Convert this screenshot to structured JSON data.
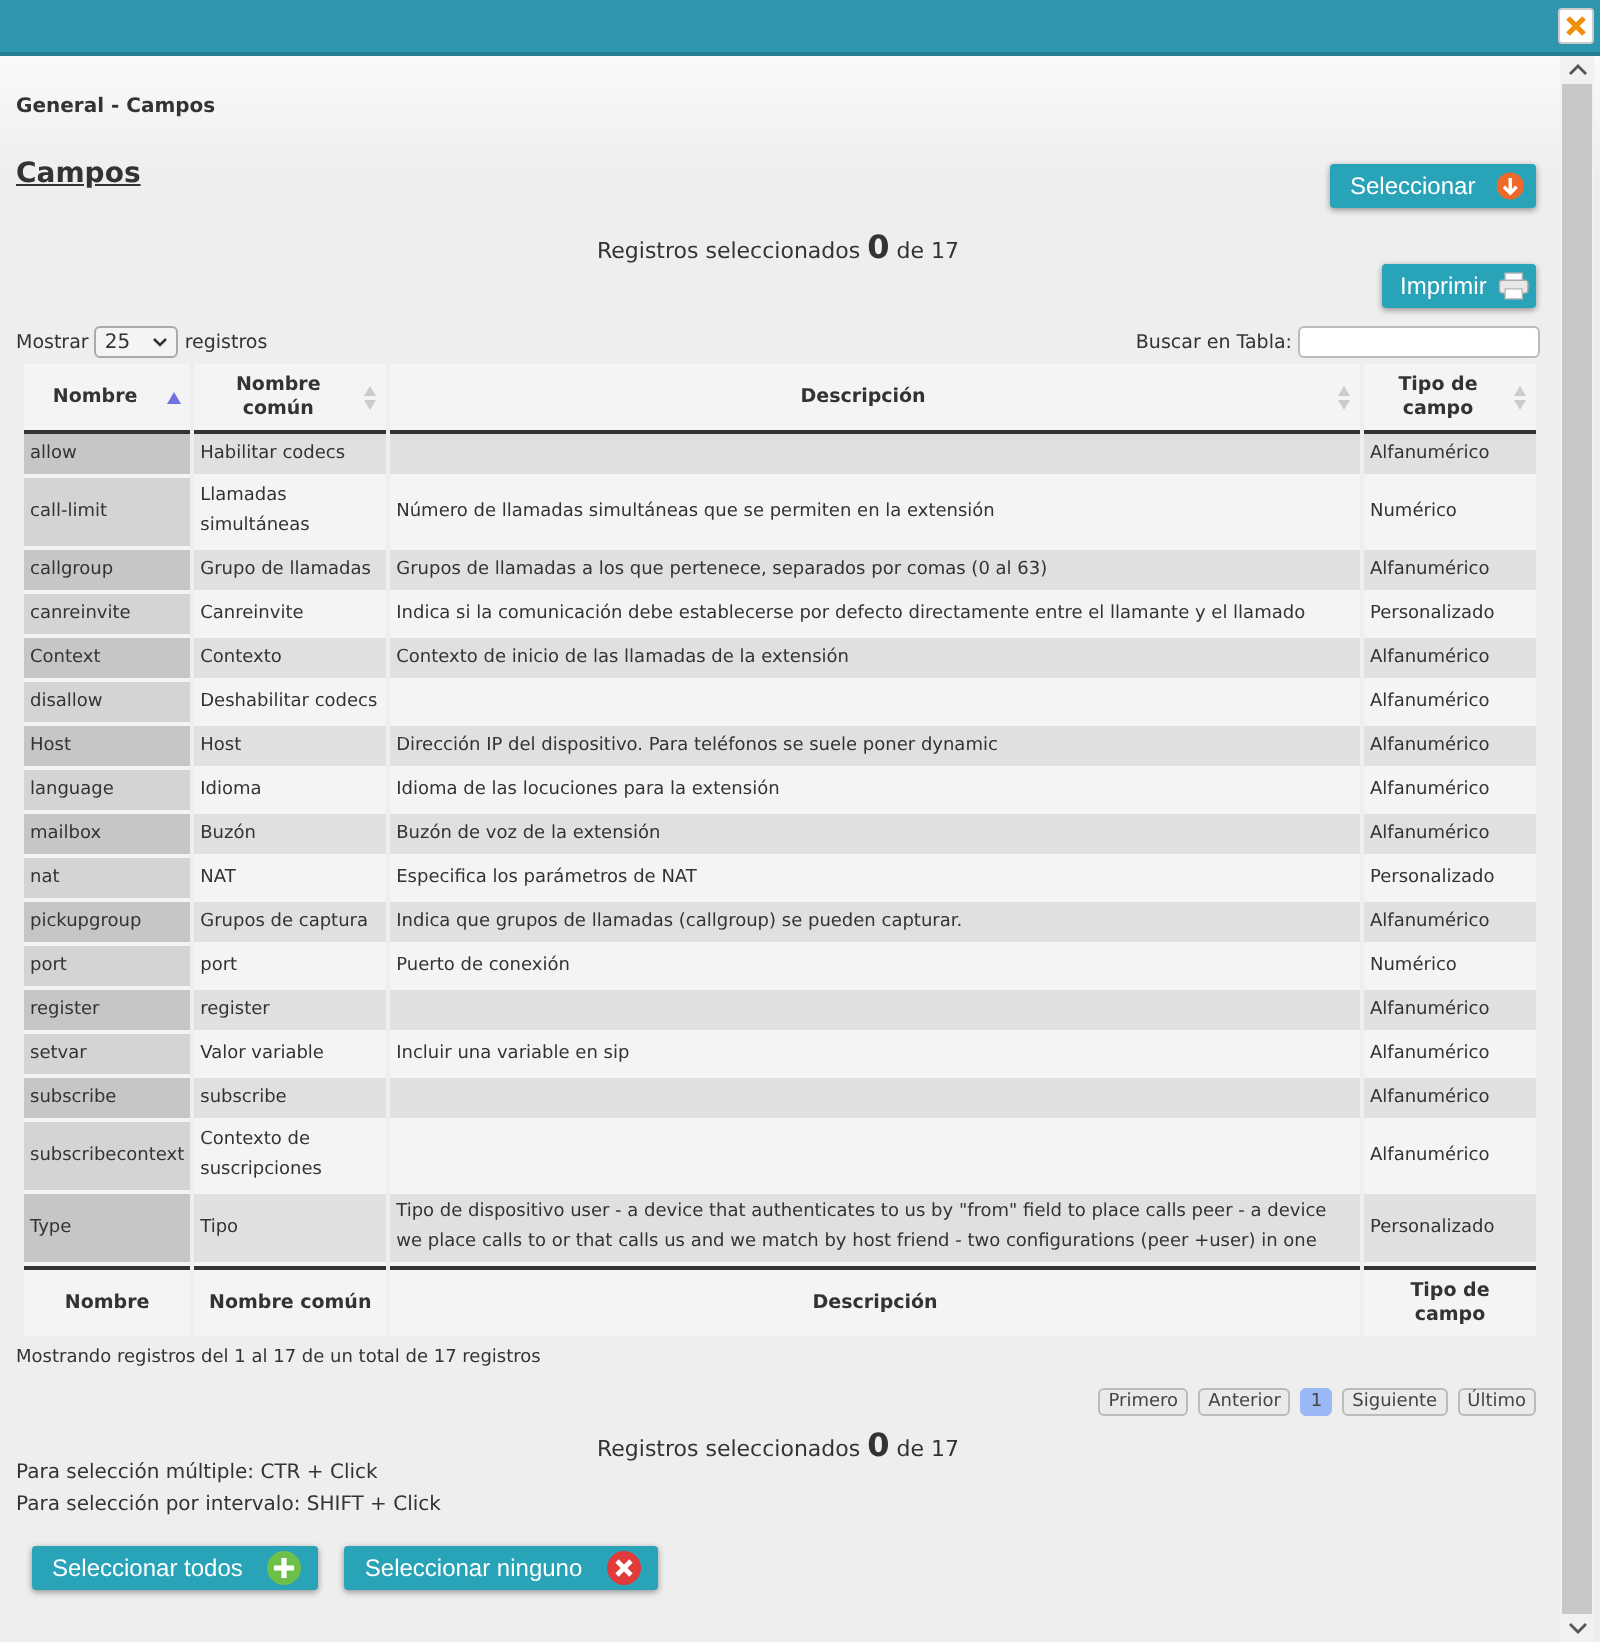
{
  "breadcrumb": "General - Campos",
  "heading": "Campos",
  "select_button": {
    "label": "Seleccionar"
  },
  "selected_count_top": "Registros seleccionados **0** de 17",
  "print_button": {
    "label": "Imprimir"
  },
  "length_control": {
    "before": "Mostrar",
    "value": "25",
    "after": "registros"
  },
  "search": {
    "label": "Buscar en Tabla:"
  },
  "table": {
    "columns": [
      {
        "label": "Nombre",
        "sorted": true
      },
      {
        "label": "Nombre común",
        "sorted": false
      },
      {
        "label": "Descripción",
        "sorted": false
      },
      {
        "label": "Tipo de campo",
        "sorted": false
      }
    ],
    "rows": [
      [
        "allow",
        "Habilitar codecs",
        "",
        "Alfanumérico"
      ],
      [
        "call-limit",
        "Llamadas simultáneas",
        "Número de llamadas simultáneas que se permiten en la extensión",
        "Numérico"
      ],
      [
        "callgroup",
        "Grupo de llamadas",
        "Grupos de llamadas a los que pertenece, separados por comas (0 al 63)",
        "Alfanumérico"
      ],
      [
        "canreinvite",
        "Canreinvite",
        "Indica si la comunicación debe establecerse por defecto directamente entre el llamante y el llamado",
        "Personalizado"
      ],
      [
        "Context",
        "Contexto",
        "Contexto de inicio de las llamadas de la extensión",
        "Alfanumérico"
      ],
      [
        "disallow",
        "Deshabilitar codecs",
        "",
        "Alfanumérico"
      ],
      [
        "Host",
        "Host",
        "Dirección IP del dispositivo. Para teléfonos se suele poner dynamic",
        "Alfanumérico"
      ],
      [
        "language",
        "Idioma",
        "Idioma de las locuciones para la extensión",
        "Alfanumérico"
      ],
      [
        "mailbox",
        "Buzón",
        "Buzón de voz de la extensión",
        "Alfanumérico"
      ],
      [
        "nat",
        "NAT",
        "Especifica los parámetros de NAT",
        "Personalizado"
      ],
      [
        "pickupgroup",
        "Grupos de captura",
        "Indica que grupos de llamadas (callgroup) se pueden capturar.",
        "Alfanumérico"
      ],
      [
        "port",
        "port",
        "Puerto de conexión",
        "Numérico"
      ],
      [
        "register",
        "register",
        "",
        "Alfanumérico"
      ],
      [
        "setvar",
        "Valor variable",
        "Incluir una variable en sip",
        "Alfanumérico"
      ],
      [
        "subscribe",
        "subscribe",
        "",
        "Alfanumérico"
      ],
      [
        "subscribecontext",
        "Contexto de suscripciones",
        "",
        "Alfanumérico"
      ],
      [
        "Type",
        "Tipo",
        "Tipo de dispositivo user - a device that authenticates to us by \"from\" field to place calls peer - a device we place calls to or that calls us and we match by host friend - two configurations (peer +user) in one",
        "Personalizado"
      ]
    ],
    "footer": [
      "Nombre",
      "Nombre común",
      "Descripción",
      "Tipo de campo"
    ]
  },
  "info": "Mostrando registros del 1 al 17 de un total de 17 registros",
  "pagination": [
    {
      "label": "Primero",
      "selected": false
    },
    {
      "label": "Anterior",
      "selected": false
    },
    {
      "label": "1",
      "selected": true
    },
    {
      "label": "Siguiente",
      "selected": false
    },
    {
      "label": "Último",
      "selected": false
    }
  ],
  "selected_count_bottom": "Registros seleccionados **0** de 17",
  "hints": [
    "Para selección múltiple: CTR + Click",
    "Para selección por intervalo: SHIFT + Click"
  ],
  "bottom_buttons": [
    {
      "label": "Seleccionar todos",
      "kind": "add"
    },
    {
      "label": "Seleccionar ninguno",
      "kind": "remove"
    }
  ]
}
